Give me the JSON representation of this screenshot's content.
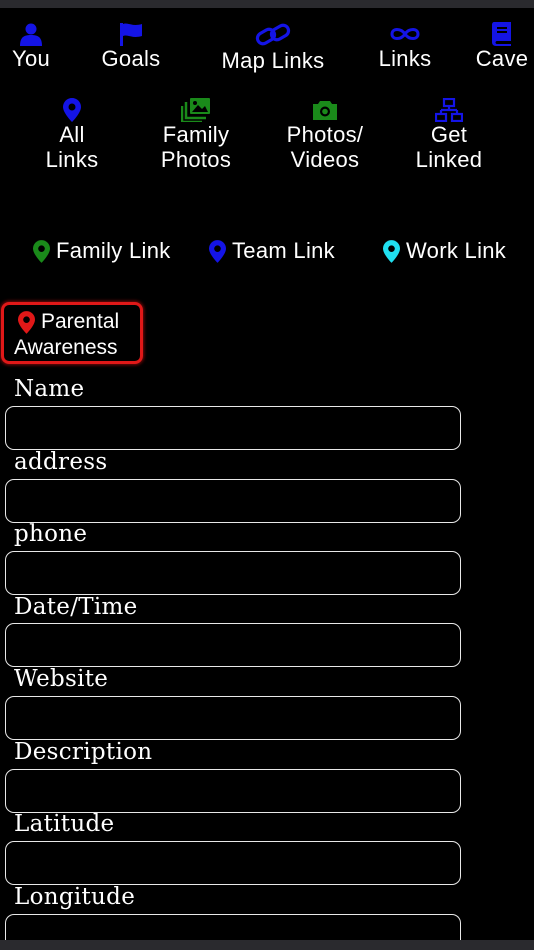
{
  "colors": {
    "nav_icon": "#1414e6",
    "family_photos_icon": "#1a8a1a",
    "photos_videos_icon": "#1a8a1a",
    "family_link_pin": "#1a8a1a",
    "team_link_pin": "#1414e6",
    "work_link_pin": "#20e0f0",
    "parental_pin": "#e01818"
  },
  "top_nav": [
    {
      "label": "You",
      "icon": "person-icon"
    },
    {
      "label": "Goals",
      "icon": "flag-icon"
    },
    {
      "label": "Map Links",
      "icon": "link-icon"
    },
    {
      "label": "Links",
      "icon": "infinity-icon"
    },
    {
      "label": "Cave",
      "icon": "book-icon"
    }
  ],
  "second_nav": [
    {
      "line1": "All",
      "line2": "Links",
      "icon": "map-pin-icon"
    },
    {
      "line1": "Family",
      "line2": "Photos",
      "icon": "photo-gallery-icon"
    },
    {
      "line1": "Photos/",
      "line2": "Videos",
      "icon": "camera-icon"
    },
    {
      "line1": "Get",
      "line2": "Linked",
      "icon": "network-icon"
    }
  ],
  "location_types": [
    {
      "label": "Family Link",
      "icon": "map-pin-icon"
    },
    {
      "label": "Team Link",
      "icon": "map-pin-icon"
    },
    {
      "label": "Work Link",
      "icon": "map-pin-icon"
    }
  ],
  "parental": {
    "line1": "Parental",
    "line2": "Awareness"
  },
  "form": {
    "fields": [
      {
        "label": "Name",
        "value": ""
      },
      {
        "label": "address",
        "value": ""
      },
      {
        "label": "phone",
        "value": ""
      },
      {
        "label": "Date/Time",
        "value": ""
      },
      {
        "label": "Website",
        "value": ""
      },
      {
        "label": "Description",
        "value": ""
      },
      {
        "label": "Latitude",
        "value": ""
      },
      {
        "label": "Longitude",
        "value": ""
      }
    ]
  }
}
